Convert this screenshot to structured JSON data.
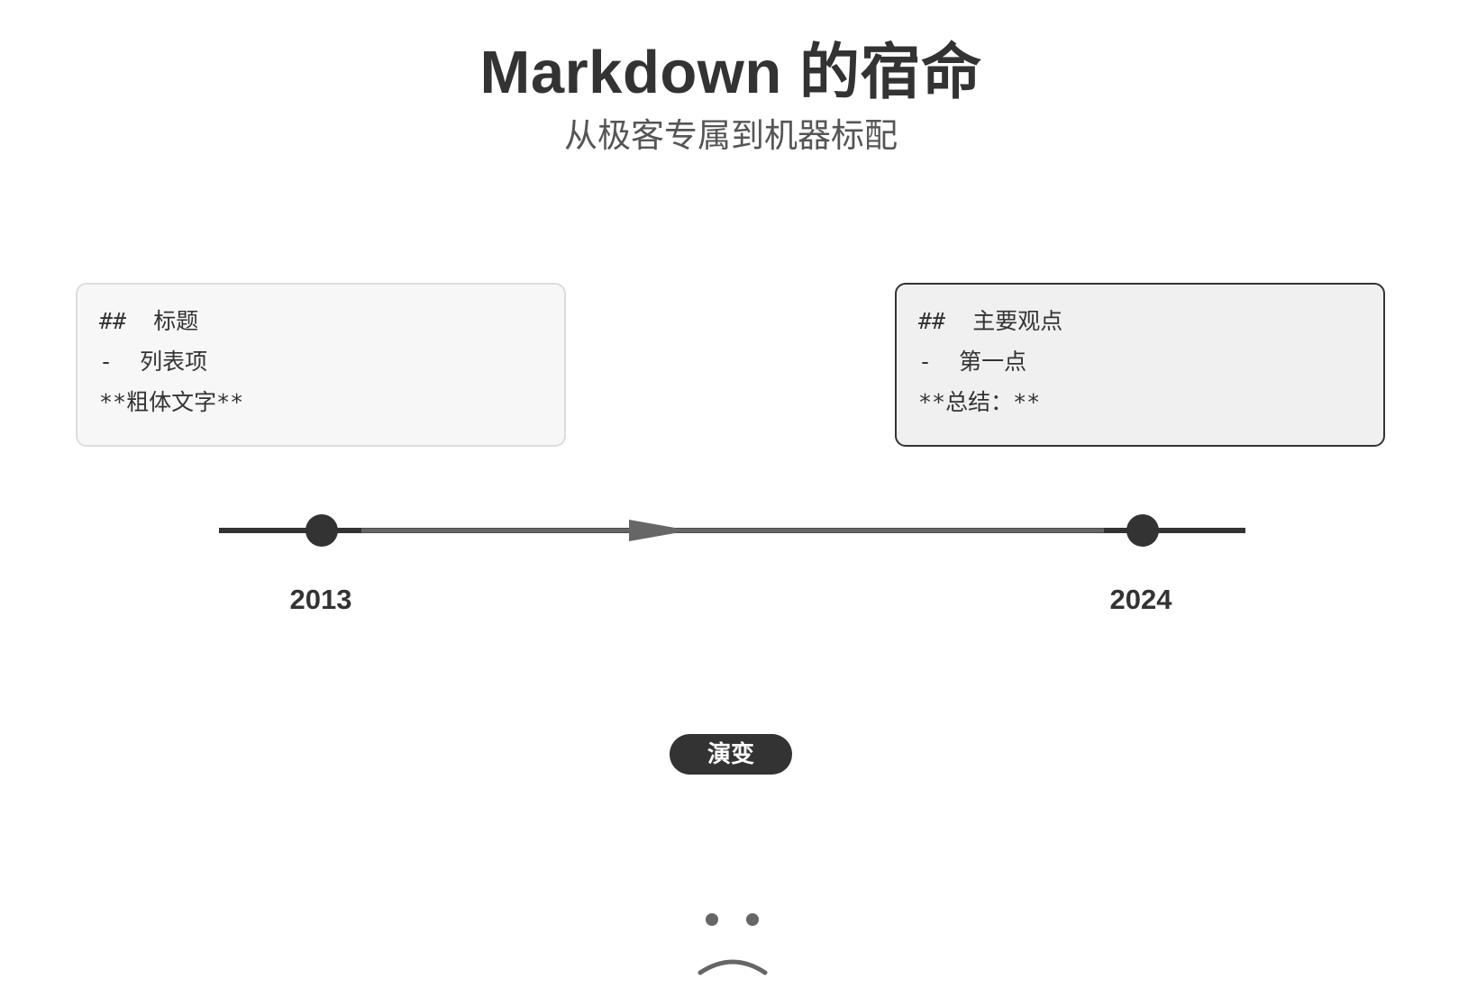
{
  "header": {
    "title": "Markdown 的宿命",
    "subtitle": "从极客专属到机器标配"
  },
  "cards": {
    "old": {
      "lines": [
        "##  标题",
        "-  列表项",
        "**粗体文字**"
      ]
    },
    "new": {
      "lines": [
        "##  主要观点",
        "-  第一点",
        "**总结：**"
      ]
    }
  },
  "timeline": {
    "start_year": "2013",
    "end_year": "2024"
  },
  "badge": {
    "label": "演变"
  },
  "colors": {
    "dark": "#333333",
    "arrow": "#666666",
    "card_old_bg": "#f7f7f7",
    "card_new_bg": "#f0f0f0"
  }
}
